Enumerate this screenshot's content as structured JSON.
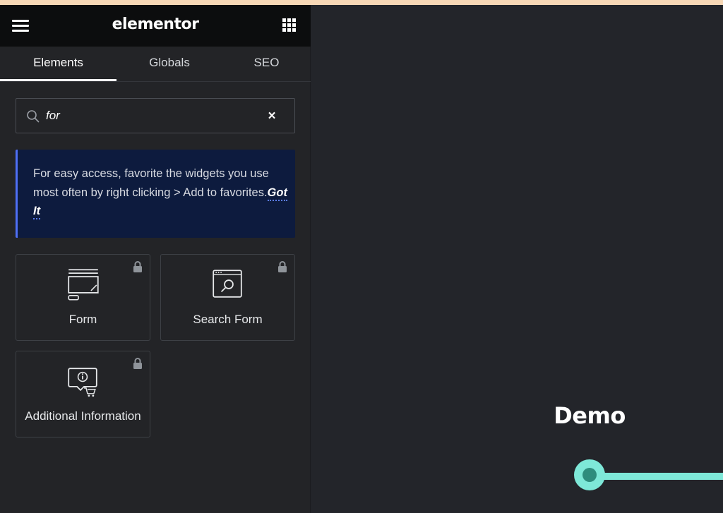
{
  "header": {
    "logo_text": "elementor",
    "menu_icon": "hamburger-icon",
    "apps_icon": "grid-apps-icon"
  },
  "tabs": [
    {
      "label": "Elements",
      "active": true
    },
    {
      "label": "Globals",
      "active": false
    },
    {
      "label": "SEO",
      "active": false
    }
  ],
  "search": {
    "value": "for",
    "icon": "search-icon",
    "clear_icon": "close-icon"
  },
  "notice": {
    "text": "For easy access, favorite the widgets you use most often by right clicking > Add to favorites.",
    "action": "Got It"
  },
  "widgets": [
    {
      "label": "Form",
      "icon": "form-icon",
      "locked": true
    },
    {
      "label": "Search Form",
      "icon": "search-form-icon",
      "locked": true
    },
    {
      "label": "Additional Information",
      "icon": "additional-information-icon",
      "locked": true
    }
  ],
  "canvas": {
    "title": "Demo"
  },
  "colors": {
    "panel_bg": "#232427",
    "header_bg": "#0c0d0e",
    "notice_bg": "#0d1b3e",
    "notice_accent": "#4f6ff5",
    "slider_accent": "#7ee8d8"
  }
}
